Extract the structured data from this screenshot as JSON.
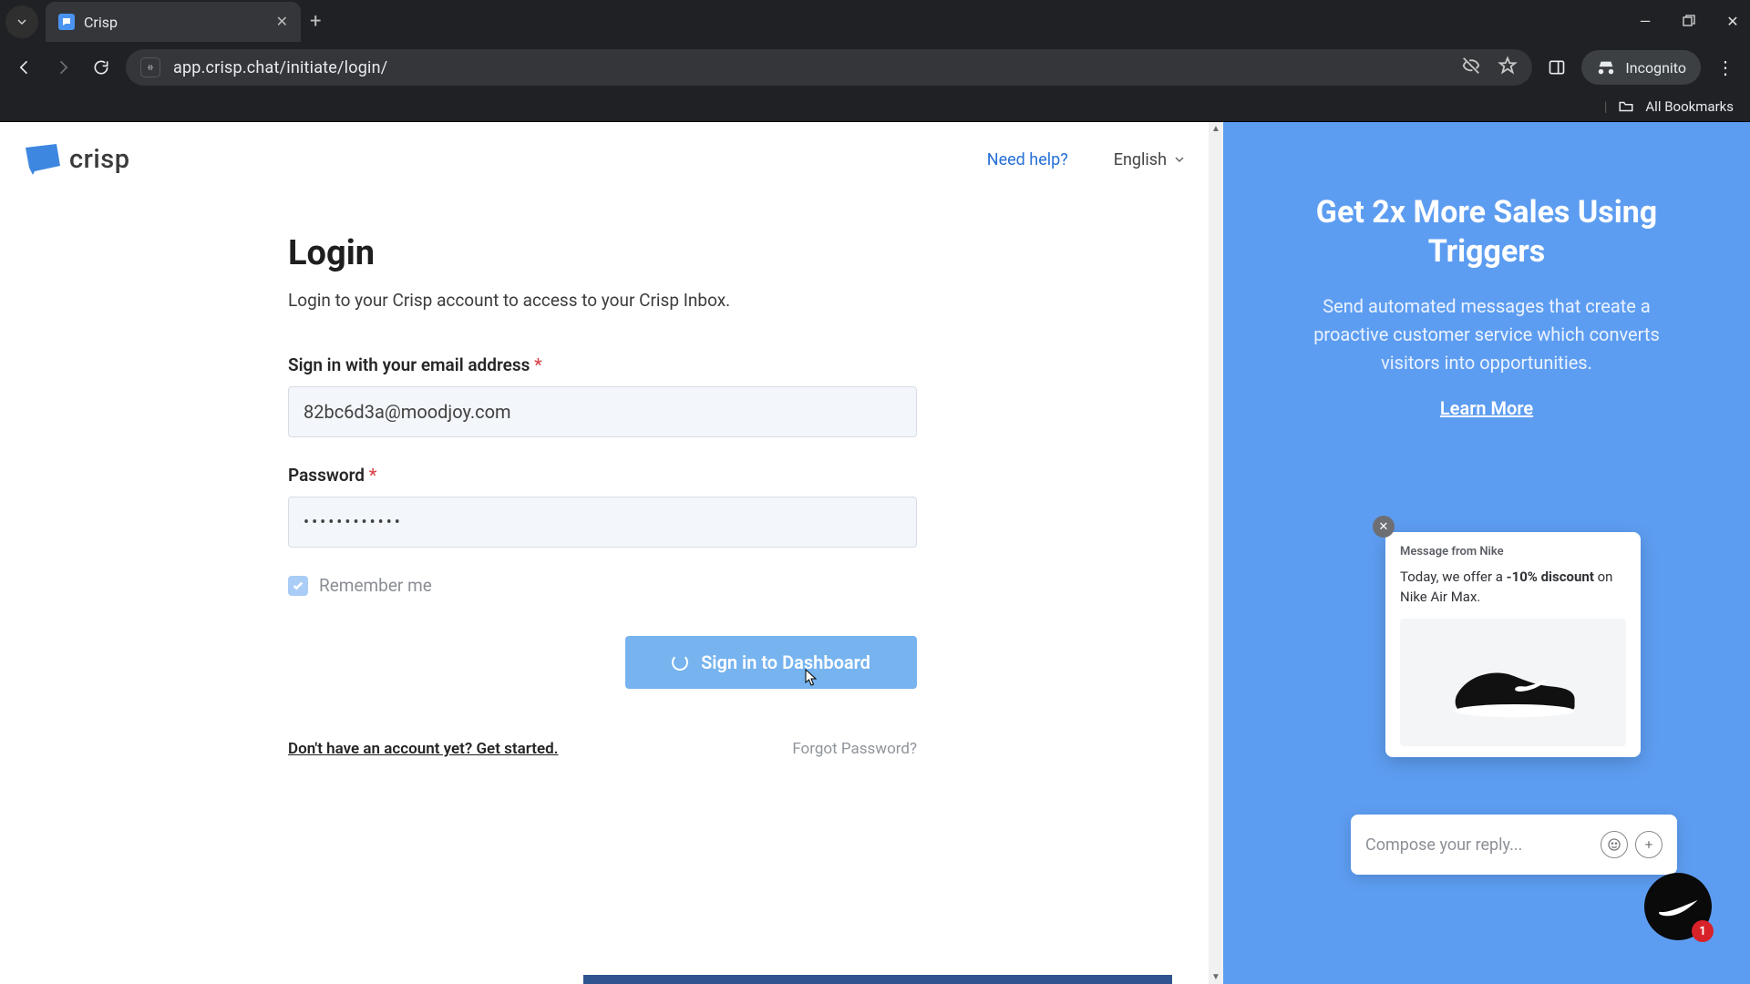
{
  "browser": {
    "tab_title": "Crisp",
    "url": "app.crisp.chat/initiate/login/",
    "incognito_label": "Incognito",
    "all_bookmarks": "All Bookmarks"
  },
  "header": {
    "brand": "crisp",
    "need_help": "Need help?",
    "language": "English"
  },
  "login": {
    "heading": "Login",
    "subheading": "Login to your Crisp account to access to your Crisp Inbox.",
    "email_label": "Sign in with your email address",
    "email_value": "82bc6d3a@moodjoy.com",
    "password_label": "Password",
    "password_value": "••••••••••••",
    "remember_label": "Remember me",
    "submit_label": "Sign in to Dashboard",
    "get_started": "Don't have an account yet? Get started.",
    "forgot": "Forgot Password?"
  },
  "promo": {
    "title": "Get 2x More Sales Using Triggers",
    "body": "Send automated messages that create a proactive customer service which converts visitors into opportunities.",
    "learn_more": "Learn More",
    "chat_from": "Message from Nike",
    "chat_line_prefix": "Today, we offer a ",
    "chat_line_bold": "-10% discount",
    "chat_line_suffix": " on Nike Air Max.",
    "compose_placeholder": "Compose your reply...",
    "badge_count": "1"
  }
}
